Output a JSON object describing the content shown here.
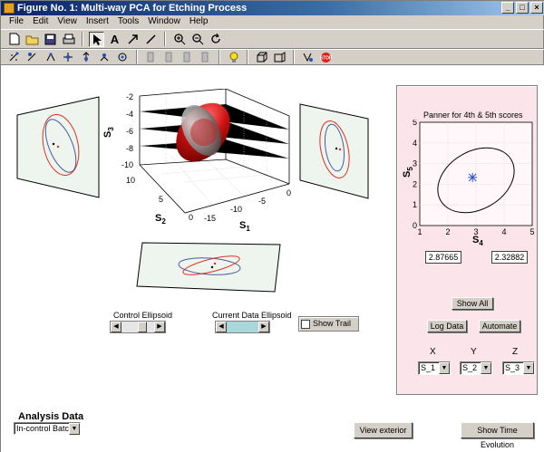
{
  "window": {
    "title": "Figure No. 1: Multi-way PCA for Etching Process"
  },
  "title_buttons": [
    "_",
    "□",
    "×"
  ],
  "menu": [
    "File",
    "Edit",
    "View",
    "Insert",
    "Tools",
    "Window",
    "Help"
  ],
  "plot3d": {
    "z_ticks": [
      "-2",
      "-4",
      "-6",
      "-8",
      "-10"
    ],
    "x_ticks": [
      "0",
      "-5",
      "-10",
      "-15"
    ],
    "y_ticks": [
      "10",
      "5",
      "0"
    ],
    "z_label": "S",
    "z_sub": "3",
    "x_label": "S",
    "x_sub": "1",
    "y_label": "S",
    "y_sub": "2"
  },
  "panner": {
    "title": "Panner for 4th & 5th scores",
    "x_ticks": [
      "1",
      "2",
      "3",
      "4",
      "5"
    ],
    "y_ticks": [
      "0",
      "1",
      "2",
      "3",
      "4",
      "5"
    ],
    "x_label": "S",
    "x_sub": "4",
    "y_label": "S",
    "y_sub": "5",
    "marker": {
      "x": 2.87665,
      "y": 2.32882
    },
    "value_left": "2.87665",
    "value_right": "2.32882",
    "show_all": "Show All",
    "log_data": "Log Data",
    "automate": "Automate",
    "axis_x_label": "X",
    "axis_y_label": "Y",
    "axis_z_label": "Z",
    "sel_x": "S_1",
    "sel_y": "S_2",
    "sel_z": "S_3"
  },
  "controls": {
    "control_ellipsoid": "Control Ellipsoid",
    "current_data_ellipsoid": "Current Data Ellipsoid",
    "show_trail": "Show Trail"
  },
  "bottom": {
    "analysis_data": "Analysis Data",
    "batch_select": "In-control Batch",
    "view_exterior": "View exterior",
    "show_time_evolution": "Show Time Evolution"
  },
  "colors": {
    "control_ellipse": "#e03020",
    "data_ellipse": "#4a5aa0",
    "panel_bg": "#fbe4ea",
    "projection_bg": "#eef4ee"
  }
}
